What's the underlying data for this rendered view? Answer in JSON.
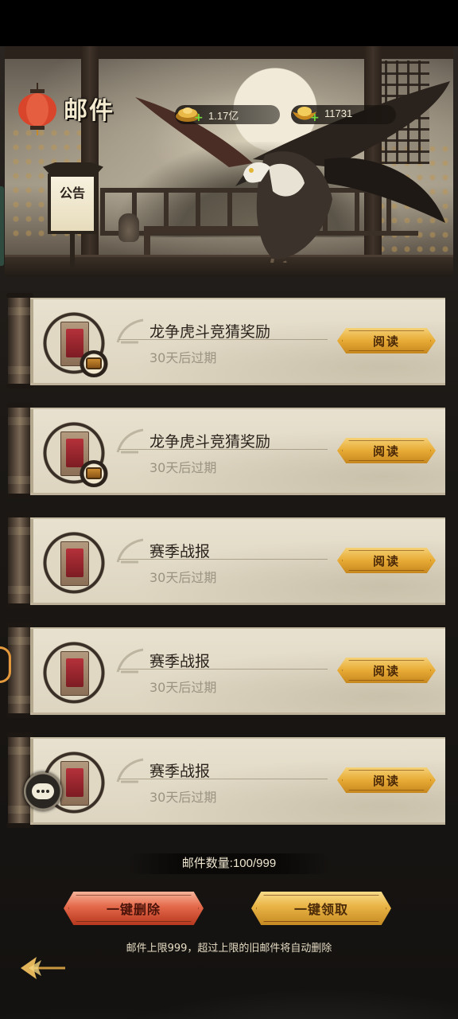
{
  "header": {
    "title": "邮件",
    "notice_label": "公告",
    "currencies": [
      {
        "name": "gold-ingot-currency",
        "value": "1.17亿"
      },
      {
        "name": "yuanbao-currency",
        "value": "11731"
      }
    ]
  },
  "mails": [
    {
      "subject": "龙争虎斗竞猜奖励",
      "expire": "30天后过期",
      "button": "阅读",
      "has_attachment": true
    },
    {
      "subject": "龙争虎斗竞猜奖励",
      "expire": "30天后过期",
      "button": "阅读",
      "has_attachment": true
    },
    {
      "subject": "赛季战报",
      "expire": "30天后过期",
      "button": "阅读",
      "has_attachment": false
    },
    {
      "subject": "赛季战报",
      "expire": "30天后过期",
      "button": "阅读",
      "has_attachment": false
    },
    {
      "subject": "赛季战报",
      "expire": "30天后过期",
      "button": "阅读",
      "has_attachment": false
    }
  ],
  "footer": {
    "count_text": "邮件数量:100/999",
    "delete_all": "一键删除",
    "claim_all": "一键领取",
    "hint": "邮件上限999，超过上限的旧邮件将自动删除"
  },
  "colors": {
    "accent_gold": "#e7ab35",
    "accent_red": "#e4684a",
    "paper": "#e8e1cf",
    "plus_green": "#6fdc3c"
  },
  "icons": [
    "lantern-icon",
    "gold-ingot-icon",
    "yuanbao-icon",
    "plus-icon",
    "envelope-icon",
    "treasure-chest-icon",
    "chat-icon",
    "back-arrow-icon"
  ]
}
